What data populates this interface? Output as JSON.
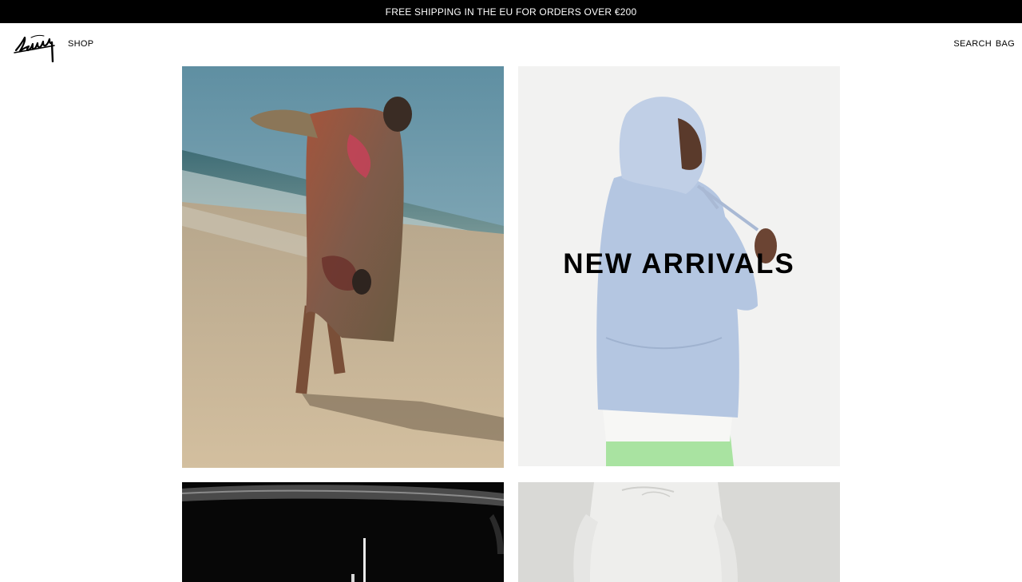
{
  "announcement": {
    "text": "FREE SHIPPING IN THE EU FOR ORDERS OVER €200"
  },
  "header": {
    "logo_name": "stussy-logo",
    "nav_left": [
      {
        "label": "SHOP"
      }
    ],
    "nav_right": [
      {
        "label": "SEARCH"
      },
      {
        "label": "BAG"
      }
    ]
  },
  "tiles": [
    {
      "caption": "",
      "image": "beach-model-photo"
    },
    {
      "caption": "NEW ARRIVALS",
      "image": "blue-hoodie-model-photo"
    },
    {
      "caption": "",
      "image": "surfboard-dark-photo"
    },
    {
      "caption": "",
      "image": "white-sweatshirt-model-photo"
    }
  ],
  "colors": {
    "announcement_bg": "#000000",
    "announcement_text": "#ffffff",
    "page_bg": "#ffffff",
    "text": "#000000"
  }
}
